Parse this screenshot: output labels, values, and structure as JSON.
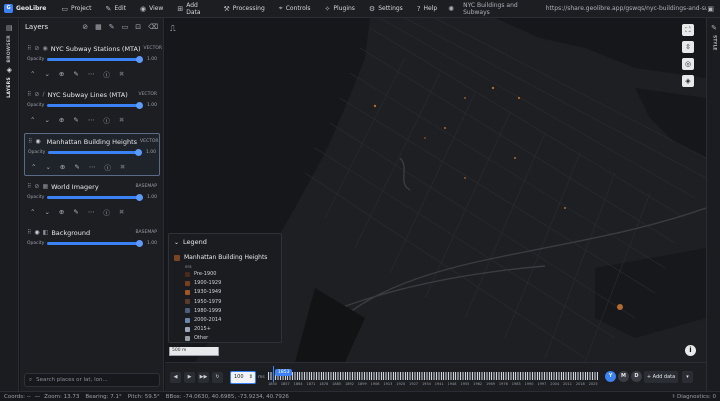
{
  "app": {
    "name": "GeoLibre"
  },
  "menu": [
    {
      "label": "Project",
      "icon": "folder-icon",
      "glyph": "▭"
    },
    {
      "label": "Edit",
      "icon": "pencil-icon",
      "glyph": "✎"
    },
    {
      "label": "View",
      "icon": "eye-icon",
      "glyph": "◉"
    },
    {
      "label": "Add Data",
      "icon": "grid-plus-icon",
      "glyph": "⊞"
    },
    {
      "label": "Processing",
      "icon": "wrench-icon",
      "glyph": "⚒"
    },
    {
      "label": "Controls",
      "icon": "cursor-icon",
      "glyph": "⌖"
    },
    {
      "label": "Plugins",
      "icon": "puzzle-icon",
      "glyph": "✧"
    },
    {
      "label": "Settings",
      "icon": "gear-icon",
      "glyph": "⚙"
    },
    {
      "label": "Help",
      "icon": "help-icon",
      "glyph": "?"
    }
  ],
  "project_title": "NYC Buildings and Subways",
  "share_url": "https://share.geolibre.app/gswqs/nyc-buildings-and-subways.geolibre.j...",
  "side_tabs": {
    "browser": "BROWSER",
    "layers": "LAYERS",
    "style": "STYLE"
  },
  "panel": {
    "title": "Layers",
    "opacity_label": "Opacity",
    "search_placeholder": "Search places or lat, lon..."
  },
  "layers": [
    {
      "name": "NYC Subway Stations (MTA)",
      "type": "VECTOR",
      "opacity": "1.00",
      "opacity_value": 1.0,
      "visible": false,
      "selected": false,
      "color": "#8a8f98"
    },
    {
      "name": "NYC Subway Lines (MTA)",
      "type": "VECTOR",
      "opacity": "1.00",
      "opacity_value": 1.0,
      "visible": false,
      "selected": false,
      "color": "#8a8f98"
    },
    {
      "name": "Manhattan Building Heights",
      "type": "VECTOR",
      "opacity": "1.00",
      "opacity_value": 1.0,
      "visible": true,
      "selected": true,
      "color": "#3b82f6"
    },
    {
      "name": "World Imagery",
      "type": "BASEMAP",
      "opacity": "1.00",
      "opacity_value": 1.0,
      "visible": false,
      "selected": false,
      "color": "#8a8f98"
    },
    {
      "name": "Background",
      "type": "BASEMAP",
      "opacity": "1.00",
      "opacity_value": 1.0,
      "visible": true,
      "selected": false,
      "color": "#8a8f98"
    }
  ],
  "legend": {
    "title": "Legend",
    "layer": "Manhattan Building Heights",
    "field": "era",
    "items": [
      {
        "label": "Pre-1900",
        "color": "#4a2a1c"
      },
      {
        "label": "1900-1929",
        "color": "#7a3e1d"
      },
      {
        "label": "1930-1949",
        "color": "#a1571f"
      },
      {
        "label": "1950-1979",
        "color": "#5b3a2a"
      },
      {
        "label": "1980-1999",
        "color": "#4d5f7a"
      },
      {
        "label": "2000-2014",
        "color": "#6b86ad"
      },
      {
        "label": "2015+",
        "color": "#9aa7b8"
      },
      {
        "label": "Other",
        "color": "#9aa0a8"
      }
    ]
  },
  "map": {
    "scale": "500 m"
  },
  "timeline": {
    "speed": "100",
    "speed_unit": "ms",
    "current_year": "1853",
    "ticks": [
      "1850",
      "1857",
      "1864",
      "1871",
      "1878",
      "1885",
      "1892",
      "1899",
      "1906",
      "1913",
      "1920",
      "1927",
      "1934",
      "1941",
      "1948",
      "1955",
      "1962",
      "1969",
      "1976",
      "1983",
      "1990",
      "1997",
      "2004",
      "2011",
      "2018",
      "2025"
    ],
    "buttons": {
      "y": "Y",
      "m": "M",
      "d": "D"
    },
    "add_data": "+ Add data"
  },
  "status": {
    "coords": "Coords: --",
    "zoom": "Zoom: 13.73",
    "bearing": "Bearing: 7.1°",
    "pitch": "Pitch: 59.5°",
    "bbox": "BBox: -74.0630, 40.6985, -73.9234, 40.7926",
    "diagnostics": "Diagnostics: 0"
  },
  "colors": {
    "accent": "#3b82f6",
    "map_bg": "#1e1f22",
    "building": "#b36a2a"
  }
}
